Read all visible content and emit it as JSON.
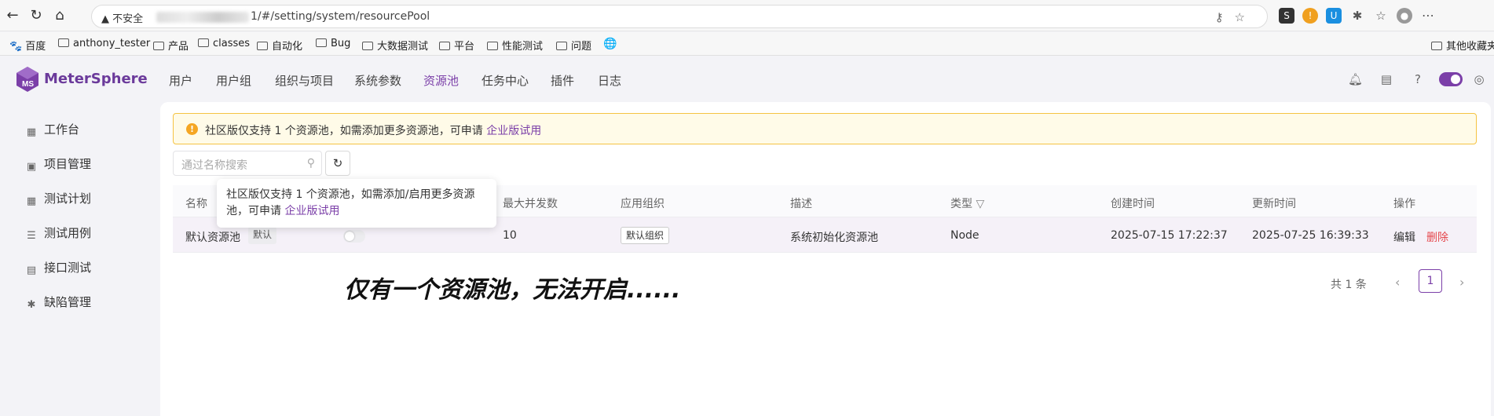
{
  "browser": {
    "not_secure": "▲ 不安全",
    "url": "1/#/setting/system/resourcePool"
  },
  "bookmarks": [
    "百度",
    "anthony_tester",
    "产品",
    "classes",
    "自动化",
    "Bug",
    "大数据测试",
    "平台",
    "性能测试",
    "问题",
    "其他收藏夹"
  ],
  "app": {
    "logo_text": "MeterSphere",
    "nav": [
      "用户",
      "用户组",
      "组织与项目",
      "系统参数",
      "资源池",
      "任务中心",
      "插件",
      "日志"
    ],
    "active_nav": "资源池",
    "accent_color": "#7b3fa8"
  },
  "sidebar": {
    "items": [
      "工作台",
      "项目管理",
      "测试计划",
      "测试用例",
      "接口测试",
      "缺陷管理"
    ]
  },
  "alert": {
    "text": "社区版仅支持 1 个资源池，如需添加更多资源池，可申请",
    "link": "企业版试用"
  },
  "search": {
    "placeholder": "通过名称搜索"
  },
  "table": {
    "headers": [
      "名称",
      "最大并发数",
      "应用组织",
      "描述",
      "类型",
      "创建时间",
      "更新时间",
      "操作"
    ],
    "row": {
      "name": "默认资源池",
      "tag": "默认",
      "enabled": false,
      "max_concurrency": "10",
      "org": "默认组织",
      "description": "系统初始化资源池",
      "type": "Node",
      "created": "2025-07-15 17:22:37",
      "updated": "2025-07-25 16:39:33",
      "edit": "编辑",
      "delete": "删除"
    }
  },
  "tooltip": {
    "text": "社区版仅支持 1 个资源池，如需添加/启用更多资源池，可申请",
    "link": "企业版试用"
  },
  "annotation": "仅有一个资源池，无法开启......",
  "pagination": {
    "total": "共 1 条",
    "current": "1"
  }
}
